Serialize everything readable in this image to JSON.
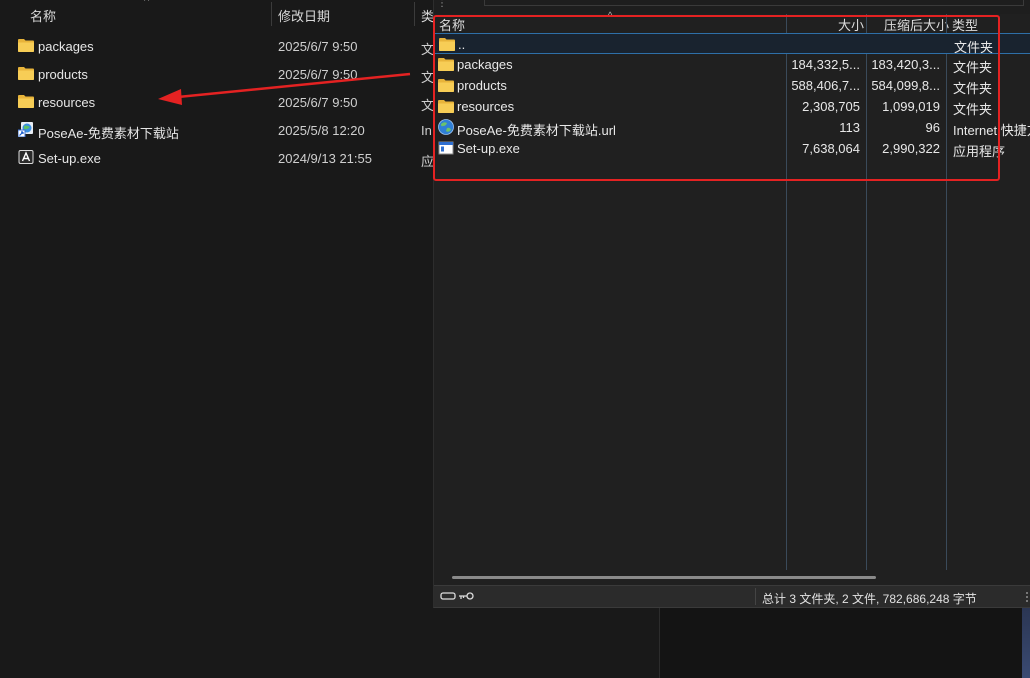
{
  "explorer": {
    "headers": {
      "name": "名称",
      "date": "修改日期",
      "type": "类"
    },
    "rows": [
      {
        "icon": "folder-icon",
        "name": "packages",
        "date": "2025/6/7 9:50",
        "type": "文"
      },
      {
        "icon": "folder-icon",
        "name": "products",
        "date": "2025/6/7 9:50",
        "type": "文"
      },
      {
        "icon": "folder-icon",
        "name": "resources",
        "date": "2025/6/7 9:50",
        "type": "文"
      },
      {
        "icon": "internet-shortcut-icon",
        "name": "PoseAe-免费素材下载站",
        "date": "2025/5/8 12:20",
        "type": "In"
      },
      {
        "icon": "installer-exe-icon",
        "name": "Set-up.exe",
        "date": "2024/9/13 21:55",
        "type": "应"
      }
    ]
  },
  "archive": {
    "headers": {
      "name": "名称",
      "size": "大小",
      "compressed": "压缩后大小",
      "type": "类型"
    },
    "rows": [
      {
        "icon": "folder-up-icon",
        "name": "..",
        "size": "",
        "compressed": "",
        "type": "文件夹",
        "selected": true
      },
      {
        "icon": "folder-icon",
        "name": "packages",
        "size": "184,332,5...",
        "compressed": "183,420,3...",
        "type": "文件夹"
      },
      {
        "icon": "folder-icon",
        "name": "products",
        "size": "588,406,7...",
        "compressed": "584,099,8...",
        "type": "文件夹"
      },
      {
        "icon": "folder-icon",
        "name": "resources",
        "size": "2,308,705",
        "compressed": "1,099,019",
        "type": "文件夹"
      },
      {
        "icon": "globe-url-icon",
        "name": "PoseAe-免费素材下载站.url",
        "size": "113",
        "compressed": "96",
        "type": "Internet 快捷方"
      },
      {
        "icon": "exe-icon",
        "name": "Set-up.exe",
        "size": "7,638,064",
        "compressed": "2,990,322",
        "type": "应用程序"
      }
    ],
    "status": "总计 3 文件夹, 2 文件, 782,686,248 字节"
  },
  "colors": {
    "annotation_red": "#e42222",
    "folder_yellow": "#f5c542",
    "selection_border": "#2e6fa8"
  }
}
